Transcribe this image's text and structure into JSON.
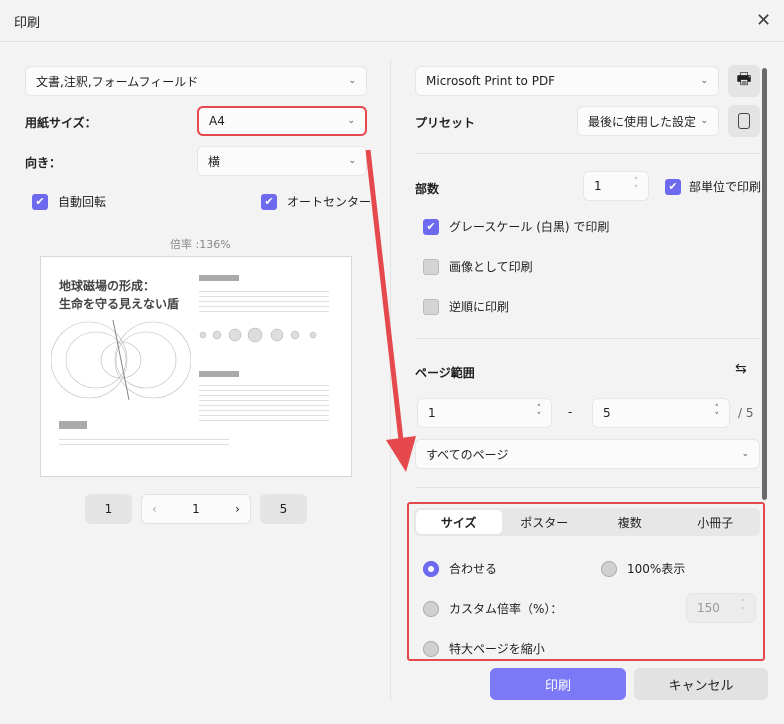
{
  "title": "印刷",
  "left": {
    "content_select": "文書,注釈,フォームフィールド",
    "paper_size_label": "用紙サイズ：",
    "paper_size": "A4",
    "orientation_label": "向き：",
    "orientation": "横",
    "auto_rotate": "自動回転",
    "auto_center": "オートセンター",
    "zoom_text": "倍率 :136%",
    "preview": {
      "heading1": "地球磁場の形成：",
      "heading2": "生命を守る見えない盾"
    },
    "pager": {
      "first": "1",
      "current": "1",
      "last": "5"
    }
  },
  "right": {
    "printer": "Microsoft Print to PDF",
    "preset_label": "プリセット",
    "preset": "最後に使用した設定",
    "copies_label": "部数",
    "copies": "1",
    "collate": "部単位で印刷",
    "grayscale": "グレースケール (白黒) で印刷",
    "as_image": "画像として印刷",
    "reverse": "逆順に印刷",
    "range_label": "ページ範囲",
    "range_from": "1",
    "range_dash": "-",
    "range_to": "5",
    "range_total": "/ 5",
    "range_select": "すべてのページ",
    "tabs": [
      "サイズ",
      "ポスター",
      "複数",
      "小冊子"
    ],
    "fit": "合わせる",
    "actual": "100%表示",
    "custom": "カスタム倍率（%）：",
    "custom_value": "150",
    "shrink": "特大ページを縮小"
  },
  "buttons": {
    "print": "印刷",
    "cancel": "キャンセル"
  },
  "colors": {
    "accent": "#6d6af0",
    "annotation": "#e5484d"
  }
}
